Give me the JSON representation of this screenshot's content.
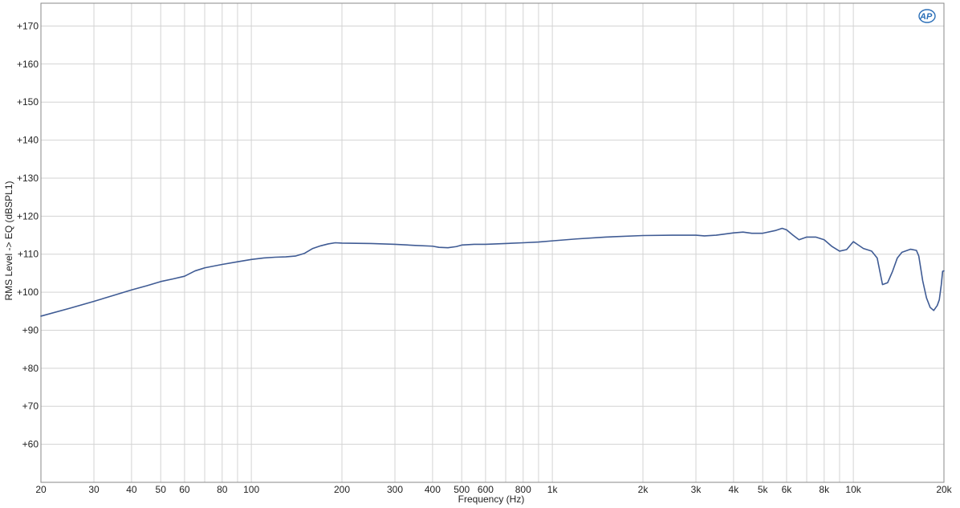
{
  "chart_data": {
    "type": "line",
    "xlabel": "Frequency (Hz)",
    "ylabel": "RMS Level -> EQ (dBSPL1)",
    "xscale": "log",
    "xlim": [
      20,
      20000
    ],
    "ylim": [
      50,
      176
    ],
    "grid": true,
    "x_ticks": [
      {
        "value": 20,
        "label": "20"
      },
      {
        "value": 30,
        "label": "30"
      },
      {
        "value": 40,
        "label": "40"
      },
      {
        "value": 50,
        "label": "50"
      },
      {
        "value": 60,
        "label": "60"
      },
      {
        "value": 80,
        "label": "80"
      },
      {
        "value": 100,
        "label": "100"
      },
      {
        "value": 200,
        "label": "200"
      },
      {
        "value": 300,
        "label": "300"
      },
      {
        "value": 400,
        "label": "400"
      },
      {
        "value": 500,
        "label": "500"
      },
      {
        "value": 600,
        "label": "600"
      },
      {
        "value": 800,
        "label": "800"
      },
      {
        "value": 1000,
        "label": "1k"
      },
      {
        "value": 2000,
        "label": "2k"
      },
      {
        "value": 3000,
        "label": "3k"
      },
      {
        "value": 4000,
        "label": "4k"
      },
      {
        "value": 5000,
        "label": "5k"
      },
      {
        "value": 6000,
        "label": "6k"
      },
      {
        "value": 8000,
        "label": "8k"
      },
      {
        "value": 10000,
        "label": "10k"
      },
      {
        "value": 20000,
        "label": "20k"
      }
    ],
    "x_grid": [
      20,
      30,
      40,
      50,
      60,
      70,
      80,
      90,
      100,
      200,
      300,
      400,
      500,
      600,
      700,
      800,
      900,
      1000,
      2000,
      3000,
      4000,
      5000,
      6000,
      7000,
      8000,
      9000,
      10000,
      20000
    ],
    "y_ticks": [
      {
        "value": 60,
        "label": "+60"
      },
      {
        "value": 70,
        "label": "+70"
      },
      {
        "value": 80,
        "label": "+80"
      },
      {
        "value": 90,
        "label": "+90"
      },
      {
        "value": 100,
        "label": "+100"
      },
      {
        "value": 110,
        "label": "+110"
      },
      {
        "value": 120,
        "label": "+120"
      },
      {
        "value": 130,
        "label": "+130"
      },
      {
        "value": 140,
        "label": "+140"
      },
      {
        "value": 150,
        "label": "+150"
      },
      {
        "value": 160,
        "label": "+160"
      },
      {
        "value": 170,
        "label": "+170"
      }
    ],
    "series": [
      {
        "color": "#3f5b94",
        "points": [
          [
            20,
            93.7
          ],
          [
            25,
            95.8
          ],
          [
            30,
            97.6
          ],
          [
            35,
            99.2
          ],
          [
            40,
            100.6
          ],
          [
            45,
            101.7
          ],
          [
            50,
            102.8
          ],
          [
            55,
            103.5
          ],
          [
            60,
            104.2
          ],
          [
            65,
            105.6
          ],
          [
            70,
            106.4
          ],
          [
            80,
            107.3
          ],
          [
            90,
            108.0
          ],
          [
            100,
            108.6
          ],
          [
            110,
            109.0
          ],
          [
            120,
            109.2
          ],
          [
            130,
            109.3
          ],
          [
            140,
            109.5
          ],
          [
            150,
            110.2
          ],
          [
            160,
            111.5
          ],
          [
            170,
            112.2
          ],
          [
            180,
            112.7
          ],
          [
            190,
            113.0
          ],
          [
            200,
            112.9
          ],
          [
            250,
            112.8
          ],
          [
            300,
            112.6
          ],
          [
            350,
            112.3
          ],
          [
            400,
            112.1
          ],
          [
            420,
            111.8
          ],
          [
            450,
            111.7
          ],
          [
            480,
            112.0
          ],
          [
            500,
            112.4
          ],
          [
            550,
            112.6
          ],
          [
            600,
            112.6
          ],
          [
            700,
            112.8
          ],
          [
            800,
            113.0
          ],
          [
            900,
            113.2
          ],
          [
            1000,
            113.5
          ],
          [
            1200,
            114.0
          ],
          [
            1500,
            114.5
          ],
          [
            2000,
            114.9
          ],
          [
            2500,
            115.0
          ],
          [
            3000,
            115.0
          ],
          [
            3200,
            114.8
          ],
          [
            3500,
            115.0
          ],
          [
            4000,
            115.6
          ],
          [
            4300,
            115.8
          ],
          [
            4600,
            115.5
          ],
          [
            5000,
            115.5
          ],
          [
            5500,
            116.2
          ],
          [
            5800,
            116.8
          ],
          [
            6000,
            116.4
          ],
          [
            6300,
            115.0
          ],
          [
            6600,
            113.8
          ],
          [
            7000,
            114.5
          ],
          [
            7500,
            114.5
          ],
          [
            8000,
            113.8
          ],
          [
            8500,
            112.0
          ],
          [
            9000,
            110.8
          ],
          [
            9500,
            111.2
          ],
          [
            10000,
            113.3
          ],
          [
            10300,
            112.6
          ],
          [
            10800,
            111.5
          ],
          [
            11500,
            110.8
          ],
          [
            12000,
            109.0
          ],
          [
            12500,
            102.0
          ],
          [
            13000,
            102.5
          ],
          [
            13500,
            105.5
          ],
          [
            14000,
            109.0
          ],
          [
            14500,
            110.5
          ],
          [
            15500,
            111.3
          ],
          [
            16200,
            111.0
          ],
          [
            16500,
            109.5
          ],
          [
            17000,
            103.0
          ],
          [
            17500,
            98.5
          ],
          [
            18000,
            96.0
          ],
          [
            18500,
            95.2
          ],
          [
            19000,
            96.5
          ],
          [
            19300,
            98.0
          ],
          [
            19600,
            102.0
          ],
          [
            19800,
            105.5
          ],
          [
            20000,
            105.6
          ]
        ]
      }
    ],
    "logo": "AP",
    "colors": {
      "grid": "#d3d3d3",
      "frame": "#8a8a8a",
      "line": "#3f5b94",
      "logo": "#2b6fb8"
    }
  }
}
